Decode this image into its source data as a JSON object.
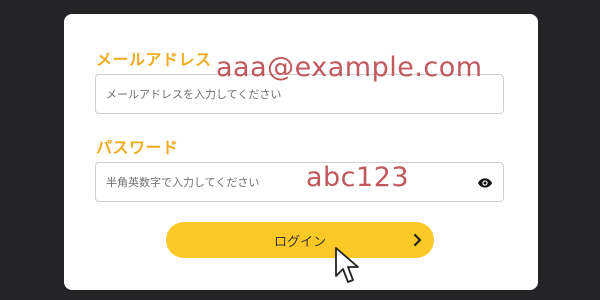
{
  "email": {
    "label": "メールアドレス",
    "placeholder": "メールアドレスを入力してください",
    "annotation": "aaa@example.com"
  },
  "password": {
    "label": "パスワード",
    "placeholder": "半角英数字で入力してください",
    "annotation": "abc123",
    "toggle_icon": "eye-icon"
  },
  "login": {
    "label": "ログイン",
    "icon": "chevron-right-icon"
  },
  "colors": {
    "label": "#f0ab1f",
    "button": "#fcc826",
    "annotation": "#c0585d",
    "background": "#242426"
  }
}
